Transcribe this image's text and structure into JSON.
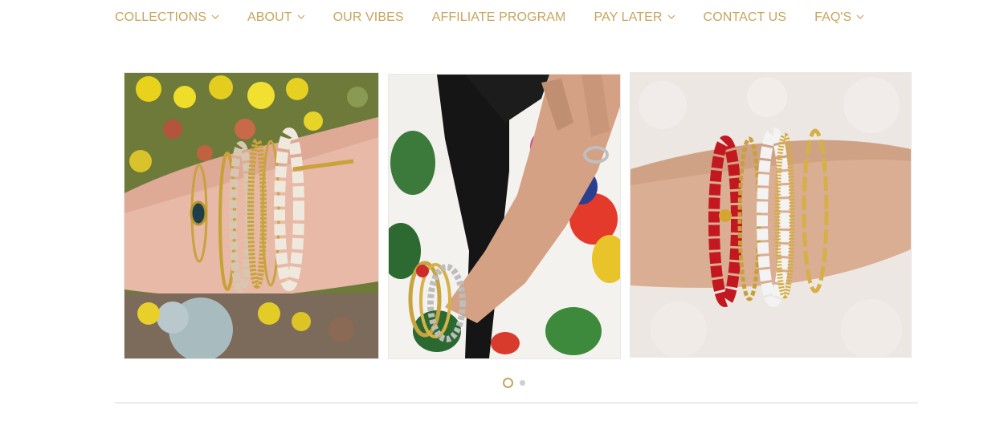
{
  "nav": {
    "items": [
      {
        "label": "COLLECTIONS",
        "has_dropdown": true
      },
      {
        "label": "ABOUT",
        "has_dropdown": true
      },
      {
        "label": "OUR VIBES",
        "has_dropdown": false
      },
      {
        "label": "AFFILIATE PROGRAM",
        "has_dropdown": false
      },
      {
        "label": "PAY LATER",
        "has_dropdown": true
      },
      {
        "label": "CONTACT US",
        "has_dropdown": false
      },
      {
        "label": "FAQ'S",
        "has_dropdown": true
      }
    ]
  },
  "carousel": {
    "slide_count": 2,
    "current_slide": 1
  },
  "colors": {
    "accent": "#c8a45c",
    "dot_inactive": "#cfcfcf",
    "divider": "#d7d7d7"
  }
}
